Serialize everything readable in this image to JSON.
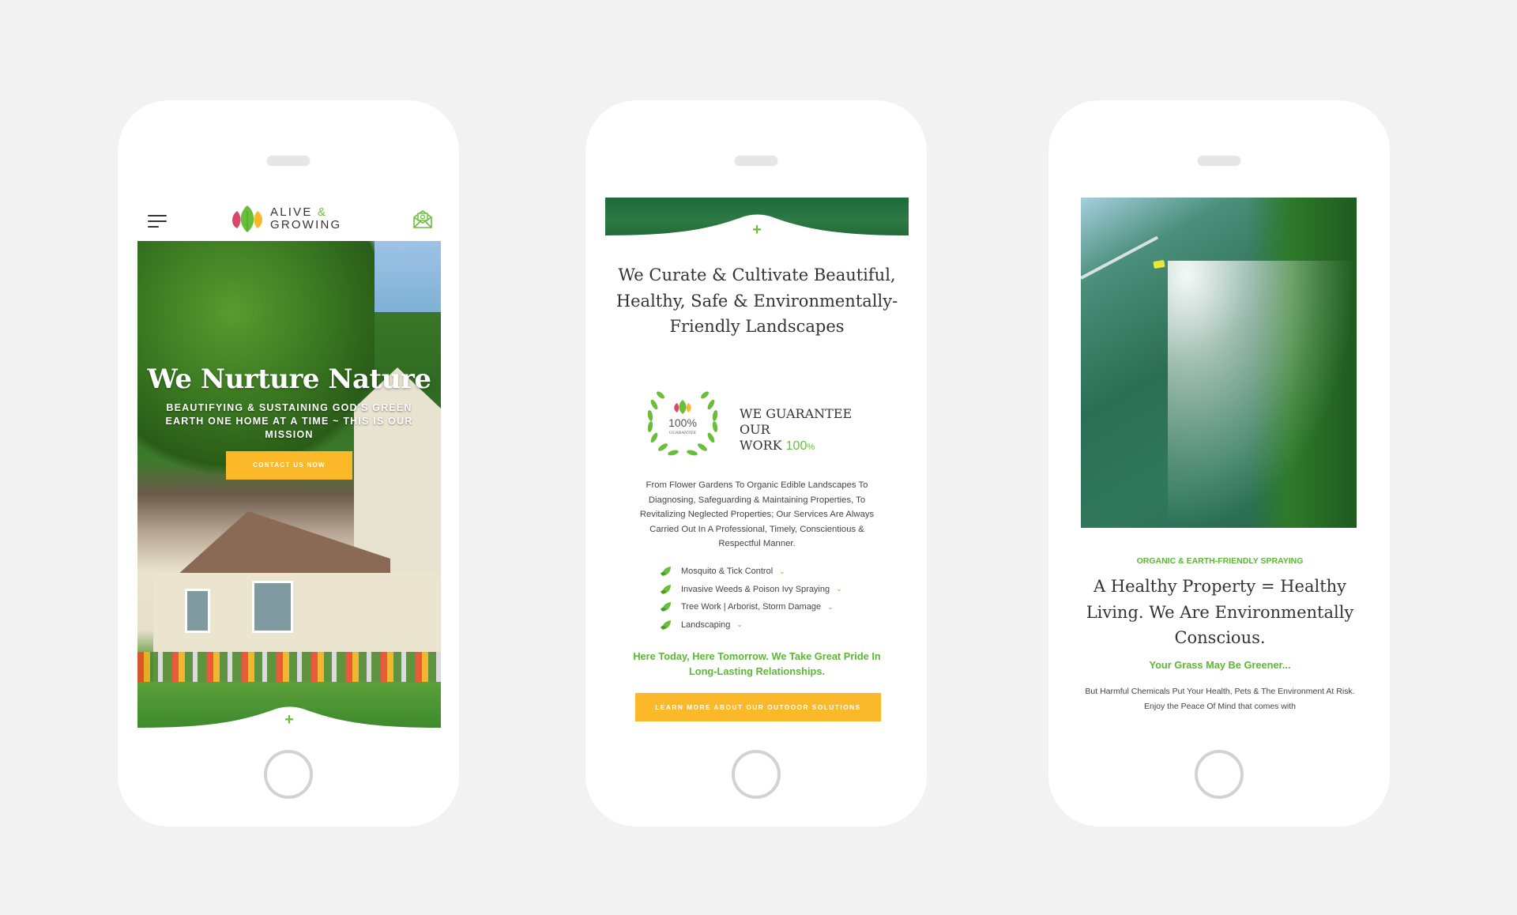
{
  "brand": {
    "name_line1": "ALIVE",
    "name_amp": "&",
    "name_line2": "GROWING",
    "colors": {
      "green": "#6abf3a",
      "yellow": "#fbb829",
      "red": "#d9486b",
      "text": "#333333"
    }
  },
  "phone1": {
    "header": {
      "menu_icon": "hamburger-menu-icon",
      "logo_icon": "three-leaves-logo-icon",
      "mail_icon": "envelope-at-icon"
    },
    "hero": {
      "title": "We Nurture Nature",
      "subtitle": "Beautifying & Sustaining God's Green Earth One Home At A Time ~ This Is Our Mission",
      "cta_label": "Contact Us Now"
    },
    "expand_icon": "+"
  },
  "phone2": {
    "expand_icon": "+",
    "title": "We Curate & Cultivate Beautiful, Healthy, Safe & Environmentally-Friendly Landscapes",
    "badge": {
      "percent": "100%",
      "label": "GUARANTEE"
    },
    "guarantee_text_line1": "WE GUARANTEE OUR",
    "guarantee_text_line2": "WORK",
    "guarantee_pct": "100",
    "guarantee_pct_sign": "%",
    "description": "From Flower Gardens To Organic Edible Landscapes To Diagnosing, Safeguarding & Maintaining Properties, To Revitalizing Neglected Properties; Our Services Are Always Carried Out In A Professional, Timely, Conscientious & Respectful Manner.",
    "services": [
      {
        "label": "Mosquito & Tick Control"
      },
      {
        "label": "Invasive Weeds & Poison Ivy Spraying"
      },
      {
        "label": "Tree Work | Arborist, Storm Damage"
      },
      {
        "label": "Landscaping"
      }
    ],
    "tagline": "Here Today, Here Tomorrow. We Take Great Pride In Long-Lasting Relationships.",
    "button_label": "Learn More About Our Outdoor Solutions"
  },
  "phone3": {
    "eyebrow": "Organic & Earth-Friendly Spraying",
    "title": "A Healthy Property = Healthy Living. We Are Environmentally Conscious.",
    "subheading": "Your Grass May Be Greener...",
    "body": "But Harmful Chemicals Put Your Health, Pets & The Environment At Risk. Enjoy the Peace Of Mind that comes with"
  }
}
